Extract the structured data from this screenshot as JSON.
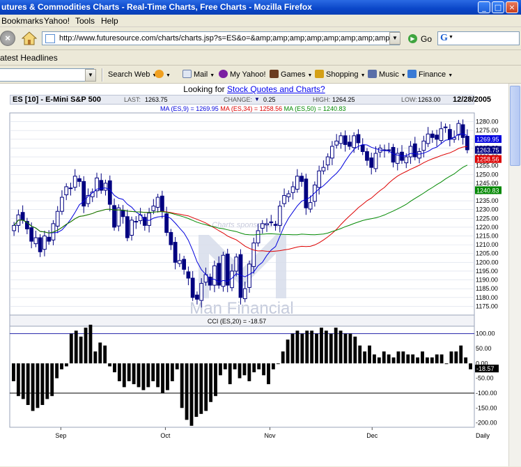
{
  "window": {
    "title": "utures & Commodities Charts - Real-Time Charts, Free Charts - Mozilla Firefox"
  },
  "menu": {
    "items": [
      "Bookmarks",
      "Yahoo!",
      "Tools",
      "Help"
    ]
  },
  "nav": {
    "url": "http://www.futuresource.com/charts/charts.jsp?s=ES&o=&amp;amp;amp;amp;amp;amp;amp;amp;amp;a=D&",
    "go_label": "Go",
    "search_logo": "G"
  },
  "bookmarks": {
    "item": "atest Headlines"
  },
  "yahoo_toolbar": {
    "search_label": "Search Web",
    "mail": "Mail",
    "my_yahoo": "My Yahoo!",
    "games": "Games",
    "shopping": "Shopping",
    "music": "Music",
    "finance": "Finance"
  },
  "page": {
    "looking_for_prefix": "Looking for ",
    "looking_for_link": "Stock Quotes and Charts?"
  },
  "chart_header": {
    "symbol": "ES [10] - E-Mini S&P 500",
    "last_label": "LAST:",
    "last": "1263.75",
    "change_label": "CHANGE:",
    "change": "0.25",
    "high_label": "HIGH:",
    "high": "1264.25",
    "low_label": "LOW:",
    "low": "1263.00",
    "date": "12/28/2005"
  },
  "ma_legend": {
    "ma9": "MA (ES,9) = 1269.95",
    "ma34": "MA (ES,34) = 1258.56",
    "ma50": "MA (ES,50) = 1240.83"
  },
  "watermark": {
    "sponsor": "Charts sponsored by",
    "brand": "Man Financial"
  },
  "cci_legend": "CCI (ES,20) = -18.57",
  "x_axis_label": "Daily",
  "colors": {
    "ma9": "#0000dd",
    "ma34": "#dd0000",
    "ma50": "#008800",
    "candle": "#000080",
    "bars": "#000000"
  },
  "chart_data": [
    {
      "type": "candlestick",
      "title": "ES [10] - E-Mini S&P 500",
      "x_ticks": [
        "Sep",
        "Oct",
        "Nov",
        "Dec"
      ],
      "ylim": [
        1170,
        1285
      ],
      "y_ticks": [
        "1280.00",
        "1275.00",
        "1270.00",
        "1265.00",
        "1260.00",
        "1255.00",
        "1250.00",
        "1245.00",
        "1240.00",
        "1235.00",
        "1230.00",
        "1225.00",
        "1220.00",
        "1215.00",
        "1210.00",
        "1205.00",
        "1200.00",
        "1195.00",
        "1190.00",
        "1185.00",
        "1180.00",
        "1175.00"
      ],
      "price_tags": [
        {
          "value": 1269.95,
          "label": "1269.95",
          "color": "#0000dd"
        },
        {
          "value": 1263.75,
          "label": "1263.75",
          "color": "#000080"
        },
        {
          "value": 1258.56,
          "label": "1258.56",
          "color": "#dd0000"
        },
        {
          "value": 1240.83,
          "label": "1240.83",
          "color": "#008800"
        }
      ],
      "closes": [
        1221,
        1227,
        1224,
        1219,
        1212,
        1214,
        1206,
        1215,
        1212,
        1222,
        1229,
        1237,
        1243,
        1242,
        1249,
        1246,
        1232,
        1238,
        1240,
        1248,
        1241,
        1245,
        1233,
        1220,
        1231,
        1226,
        1214,
        1224,
        1223,
        1227,
        1221,
        1228,
        1232,
        1237,
        1229,
        1217,
        1210,
        1200,
        1201,
        1196,
        1191,
        1180,
        1179,
        1188,
        1193,
        1187,
        1198,
        1187,
        1204,
        1187,
        1195,
        1203,
        1180,
        1185,
        1199,
        1211,
        1218,
        1222,
        1222,
        1223,
        1221,
        1232,
        1238,
        1239,
        1243,
        1249,
        1246,
        1231,
        1234,
        1244,
        1252,
        1254,
        1260,
        1266,
        1269,
        1272,
        1267,
        1266,
        1272,
        1268,
        1263,
        1258,
        1254,
        1262,
        1265,
        1264,
        1264,
        1257,
        1262,
        1258,
        1260,
        1266,
        1260,
        1263,
        1269,
        1273,
        1271,
        1270,
        1276,
        1277,
        1270,
        1271,
        1279,
        1271,
        1264
      ]
    },
    {
      "type": "bar",
      "title": "CCI (ES,20) = -18.57",
      "ylim": [
        -215,
        125
      ],
      "y_ticks": [
        "100.00",
        "50.00",
        "0.00",
        "-50.00",
        "-100.00",
        "-150.00",
        "-200.00"
      ],
      "reference_lines": [
        100,
        -100
      ],
      "current": "-18.57",
      "values": [
        -60,
        -110,
        -120,
        -140,
        -160,
        -150,
        -140,
        -120,
        -110,
        -50,
        -20,
        -10,
        100,
        110,
        90,
        120,
        130,
        40,
        70,
        60,
        -10,
        -30,
        -60,
        -80,
        -60,
        -70,
        -80,
        -90,
        -80,
        -60,
        -80,
        -100,
        -90,
        -60,
        -20,
        -150,
        -190,
        -210,
        -180,
        -170,
        -160,
        -130,
        -110,
        -40,
        -20,
        -70,
        -20,
        -50,
        -40,
        -60,
        -30,
        -20,
        -40,
        -70,
        -20,
        0,
        40,
        80,
        100,
        110,
        100,
        110,
        110,
        100,
        120,
        110,
        100,
        120,
        110,
        100,
        100,
        90,
        60,
        40,
        60,
        30,
        20,
        40,
        30,
        20,
        40,
        40,
        30,
        30,
        20,
        40,
        20,
        20,
        30,
        30,
        0,
        40,
        40,
        60,
        20,
        -20
      ],
      "label_ticks": [
        "Daily"
      ]
    }
  ]
}
